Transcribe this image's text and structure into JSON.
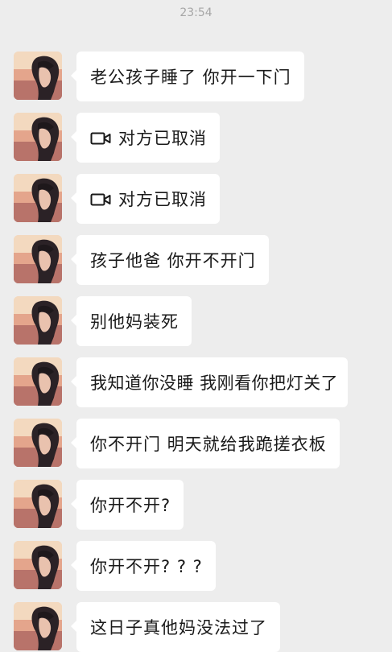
{
  "timestamp": "23:54",
  "messages": [
    {
      "text": "老公孩子睡了 你开一下门",
      "type": "text"
    },
    {
      "text": "对方已取消",
      "type": "video-call",
      "icon": "video-camera-icon"
    },
    {
      "text": "对方已取消",
      "type": "video-call",
      "icon": "video-camera-icon"
    },
    {
      "text": "孩子他爸 你开不开门",
      "type": "text"
    },
    {
      "text": "别他妈装死",
      "type": "text"
    },
    {
      "text": "我知道你没睡 我刚看你把灯关了",
      "type": "text"
    },
    {
      "text": "你不开门 明天就给我跪搓衣板",
      "type": "text"
    },
    {
      "text": "你开不开?",
      "type": "text"
    },
    {
      "text": "你开不开? ? ?",
      "type": "text"
    },
    {
      "text": "这日子真他妈没法过了",
      "type": "text"
    }
  ],
  "colors": {
    "background": "#ededed",
    "bubble": "#ffffff",
    "text": "#1a1a1a",
    "timestamp": "#a6a6a6"
  }
}
